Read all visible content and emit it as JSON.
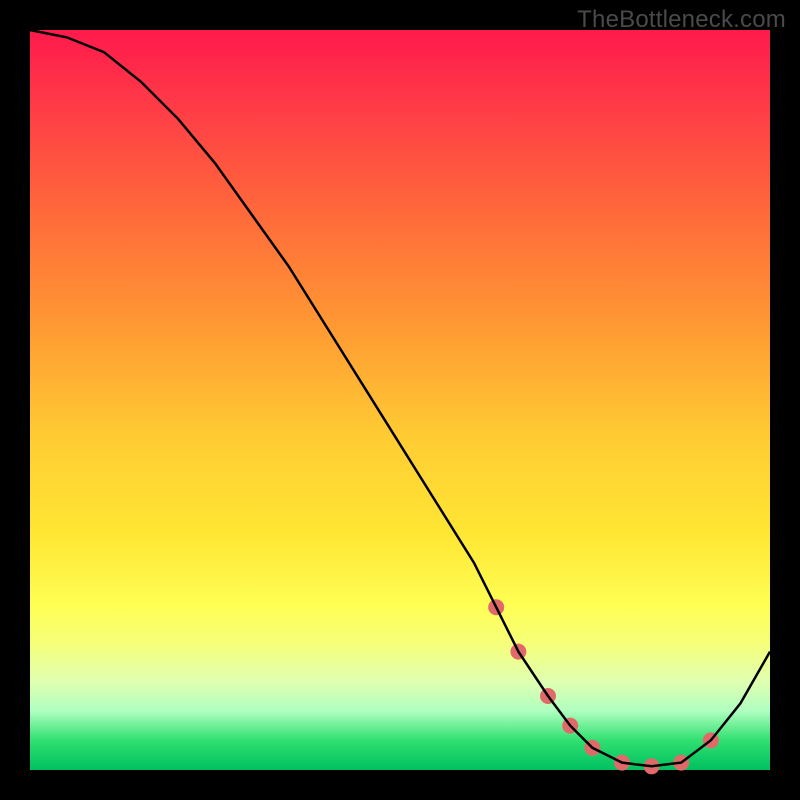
{
  "watermark": "TheBottleneck.com",
  "chart_data": {
    "type": "line",
    "title": "",
    "xlabel": "",
    "ylabel": "",
    "xlim": [
      0,
      100
    ],
    "ylim": [
      0,
      100
    ],
    "series": [
      {
        "name": "bottleneck-curve",
        "x": [
          0,
          5,
          10,
          15,
          20,
          25,
          30,
          35,
          40,
          45,
          50,
          55,
          60,
          63,
          66,
          70,
          73,
          76,
          80,
          84,
          88,
          92,
          96,
          100
        ],
        "values": [
          100,
          99,
          97,
          93,
          88,
          82,
          75,
          68,
          60,
          52,
          44,
          36,
          28,
          22,
          16,
          10,
          6,
          3,
          1,
          0.5,
          1,
          4,
          9,
          16
        ]
      }
    ],
    "markers": {
      "name": "highlight-dots",
      "x": [
        63,
        66,
        70,
        73,
        76,
        80,
        84,
        88,
        92
      ],
      "values": [
        22,
        16,
        10,
        6,
        3,
        1,
        0.5,
        1,
        4
      ],
      "color": "#e06a6a",
      "radius_px": 8
    },
    "colors": {
      "gradient_top": "#ff1a4c",
      "gradient_mid": "#ffe633",
      "gradient_bottom": "#00c060",
      "curve": "#000000",
      "frame": "#000000"
    }
  }
}
